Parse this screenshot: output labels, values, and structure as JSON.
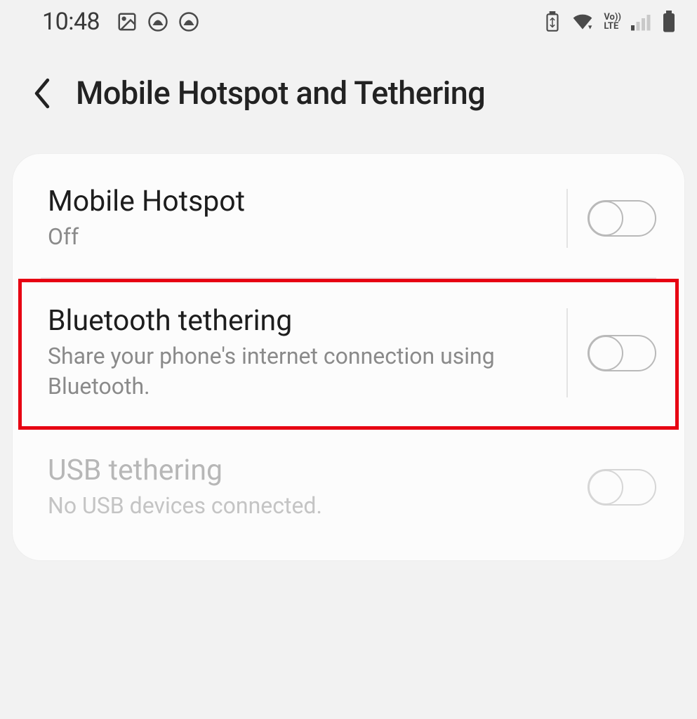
{
  "status": {
    "time": "10:48",
    "icons_left": [
      "image-icon",
      "app-icon-1",
      "app-icon-2"
    ],
    "icons_right": [
      "recycle-battery-icon",
      "wifi-icon",
      "volte-icon",
      "signal-icon",
      "battery-icon"
    ],
    "volte_label": "Vo))\nLTE"
  },
  "header": {
    "title": "Mobile Hotspot and Tethering"
  },
  "rows": {
    "hotspot": {
      "title": "Mobile Hotspot",
      "sub": "Off",
      "toggle_on": false,
      "enabled": true
    },
    "bluetooth": {
      "title": "Bluetooth tethering",
      "sub": "Share your phone's internet connection using Bluetooth.",
      "toggle_on": false,
      "enabled": true,
      "highlighted": true
    },
    "usb": {
      "title": "USB tethering",
      "sub": "No USB devices connected.",
      "toggle_on": false,
      "enabled": false
    }
  }
}
